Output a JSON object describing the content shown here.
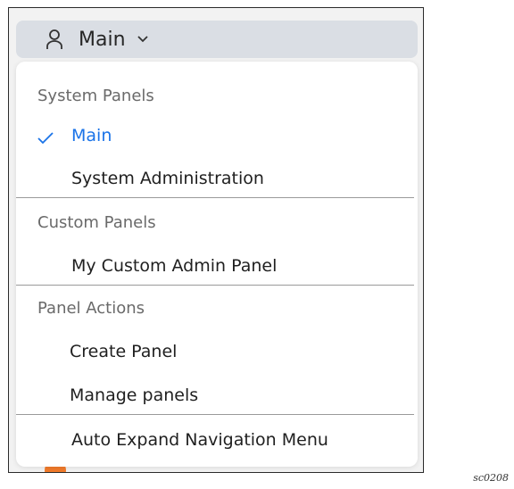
{
  "trigger": {
    "icon": "user-icon",
    "label": "Main",
    "chevron": "chevron-down-icon"
  },
  "menu": {
    "sections": [
      {
        "heading": "System Panels",
        "items": [
          {
            "label": "Main",
            "selected": true
          },
          {
            "label": "System Administration",
            "selected": false
          }
        ]
      },
      {
        "heading": "Custom Panels",
        "items": [
          {
            "label": "My Custom Admin Panel",
            "selected": false
          }
        ]
      },
      {
        "heading": "Panel Actions",
        "items": [
          {
            "label": "Create Panel",
            "selected": false
          },
          {
            "label": "Manage panels",
            "selected": false
          }
        ]
      }
    ],
    "footer_item": "Auto Expand Navigation Menu"
  },
  "caption": "sc0208",
  "colors": {
    "accent": "#1a73e8",
    "trigger_bg": "#dadee4",
    "menu_bg": "#ffffff"
  }
}
